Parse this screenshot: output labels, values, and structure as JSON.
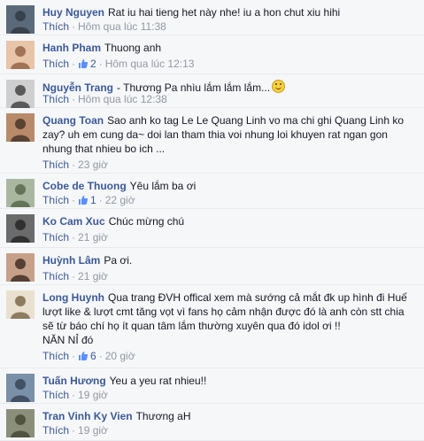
{
  "comments": [
    {
      "author": "Huy Nguyen",
      "text": "Rat iu hai tieng het này nhe! iu a hon chut xiu hihi",
      "like_label": "Thích",
      "likes": "",
      "time": "Hôm qua lúc 11:38",
      "emoji": false
    },
    {
      "author": "Hanh Pham",
      "text": "Thuong anh",
      "like_label": "Thích",
      "likes": "2",
      "time": "Hôm qua lúc 12:13",
      "emoji": false
    },
    {
      "author": "Nguyễn Trang",
      "text": "- Thương Pa nhìu lắm lắm lắm...",
      "like_label": "Thích",
      "likes": "",
      "time": "Hôm qua lúc 12:38",
      "emoji": true
    },
    {
      "author": "Quang Toan",
      "text": "Sao anh ko tag Le Le Quang Linh vo ma chi ghi Quang Linh ko zay? uh em cung da~ doi lan tham thia voi nhung loi khuyen rat ngan gon nhung that nhieu bo ich ...",
      "like_label": "Thích",
      "likes": "",
      "time": "23 giờ",
      "emoji": false
    },
    {
      "author": "Cobe de Thuong",
      "text": "Yêu lắm ba ơi",
      "like_label": "Thích",
      "likes": "1",
      "time": "22 giờ",
      "emoji": false
    },
    {
      "author": "Ko Cam Xuc",
      "text": "Chúc mừng chú",
      "like_label": "Thích",
      "likes": "",
      "time": "21 giờ",
      "emoji": false
    },
    {
      "author": "Huỳnh Lâm",
      "text": "Pa ơi.",
      "like_label": "Thích",
      "likes": "",
      "time": "21 giờ",
      "emoji": false
    },
    {
      "author": "Long Huynh",
      "text": "Qua trang ĐVH offical xem mà sướng cả mắt đk up hình đi Huế lượt like & lượt cmt tăng vọt vì fans họ cảm nhận được đó là anh còn stt chia sẽ từ báo chí họ ít quan tâm lắm thường xuyên qua đó idol ơi !!\nNĂN NỈ đó",
      "like_label": "Thích",
      "likes": "6",
      "time": "20 giờ",
      "emoji": false
    },
    {
      "author": "Tuấn Hương",
      "text": "Yeu a yeu rat nhieu!!",
      "like_label": "Thích",
      "likes": "",
      "time": "19 giờ",
      "emoji": false
    },
    {
      "author": "Tran Vinh Ky Vien",
      "text": "Thương aH",
      "like_label": "Thích",
      "likes": "",
      "time": "19 giờ",
      "emoji": false
    }
  ],
  "colors": {
    "link": "#3b5998",
    "meta": "#9197a3",
    "background": "#f6f7f9",
    "separator": "#e9eaed"
  }
}
